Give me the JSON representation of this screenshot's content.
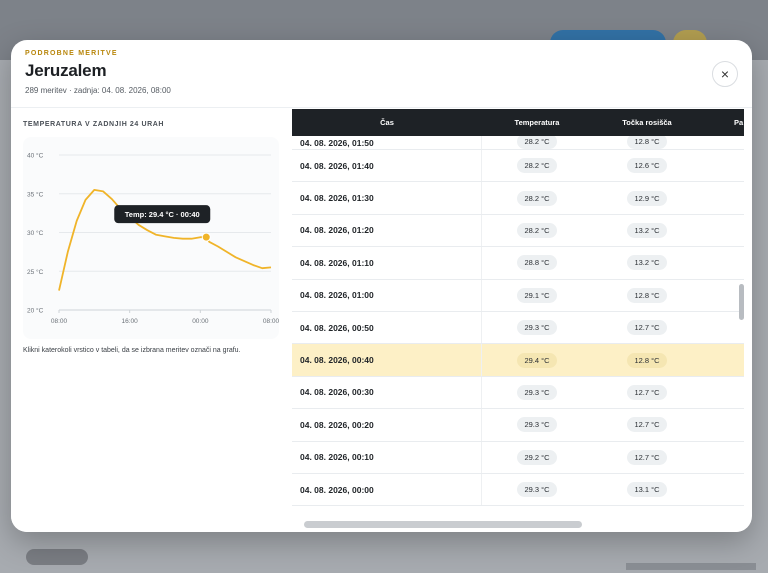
{
  "header": {
    "eyebrow": "PODROBNE MERITVE",
    "station": "Jeruzalem",
    "subline": "289 meritev · zadnja: 04. 08. 2026, 08:00",
    "close_label": "×"
  },
  "left_panel": {
    "title": "TEMPERATURA V ZADNJIH 24 URAH",
    "hint": "Klikni katerokoli vrstico v tabeli, da se izbrana meritev označi na grafu."
  },
  "chart_data": {
    "type": "line",
    "xlabel": "",
    "ylabel": "",
    "ylim": [
      20,
      40
    ],
    "y_ticks": [
      "20 °C",
      "25 °C",
      "30 °C",
      "35 °C",
      "40 °C"
    ],
    "x_tick_labels": [
      "08:00",
      "16:00",
      "00:00",
      "08:00"
    ],
    "x_ticks_hours": [
      0,
      8,
      16,
      24
    ],
    "series": [
      {
        "color": "#f0b429",
        "x_hours": [
          0,
          1,
          2,
          3,
          4,
          5,
          6,
          7,
          8,
          9,
          10,
          11,
          12,
          13,
          14,
          15,
          16,
          16.67,
          17,
          18,
          19,
          20,
          21,
          22,
          23,
          24
        ],
        "values": [
          22.5,
          27.5,
          31.5,
          34.2,
          35.5,
          35.3,
          34.3,
          33.0,
          32.0,
          31.0,
          30.3,
          29.7,
          29.5,
          29.3,
          29.2,
          29.2,
          29.4,
          29.4,
          28.8,
          28.2,
          27.5,
          26.8,
          26.3,
          25.8,
          25.4,
          25.5
        ]
      }
    ],
    "highlight": {
      "x_hours": 16.67,
      "value": 29.4,
      "tooltip": "Temp: 29.4 °C · 00:40"
    },
    "grid": true
  },
  "table": {
    "headers": [
      "Čas",
      "Temperatura",
      "Točka rosišča",
      "Pa"
    ],
    "partial_top": {
      "time": "04. 08. 2026, 01:50",
      "temp": "28.2 °C",
      "dew": "12.8 °C",
      "more": "0"
    },
    "rows": [
      {
        "time": "04. 08. 2026, 01:40",
        "temp": "28.2 °C",
        "dew": "12.6 °C",
        "more": "0",
        "selected": false
      },
      {
        "time": "04. 08. 2026, 01:30",
        "temp": "28.2 °C",
        "dew": "12.9 °C",
        "more": "0",
        "selected": false
      },
      {
        "time": "04. 08. 2026, 01:20",
        "temp": "28.2 °C",
        "dew": "13.2 °C",
        "more": "0",
        "selected": false
      },
      {
        "time": "04. 08. 2026, 01:10",
        "temp": "28.8 °C",
        "dew": "13.2 °C",
        "more": "0",
        "selected": false
      },
      {
        "time": "04. 08. 2026, 01:00",
        "temp": "29.1 °C",
        "dew": "12.8 °C",
        "more": "0",
        "selected": false
      },
      {
        "time": "04. 08. 2026, 00:50",
        "temp": "29.3 °C",
        "dew": "12.7 °C",
        "more": "0",
        "selected": false
      },
      {
        "time": "04. 08. 2026, 00:40",
        "temp": "29.4 °C",
        "dew": "12.8 °C",
        "more": "0",
        "selected": true
      },
      {
        "time": "04. 08. 2026, 00:30",
        "temp": "29.3 °C",
        "dew": "12.7 °C",
        "more": "0",
        "selected": false
      },
      {
        "time": "04. 08. 2026, 00:20",
        "temp": "29.3 °C",
        "dew": "12.7 °C",
        "more": "0",
        "selected": false
      },
      {
        "time": "04. 08. 2026, 00:10",
        "temp": "29.2 °C",
        "dew": "12.7 °C",
        "more": "0",
        "selected": false
      },
      {
        "time": "04. 08. 2026, 00:00",
        "temp": "29.3 °C",
        "dew": "13.1 °C",
        "more": "0",
        "selected": false
      }
    ]
  }
}
